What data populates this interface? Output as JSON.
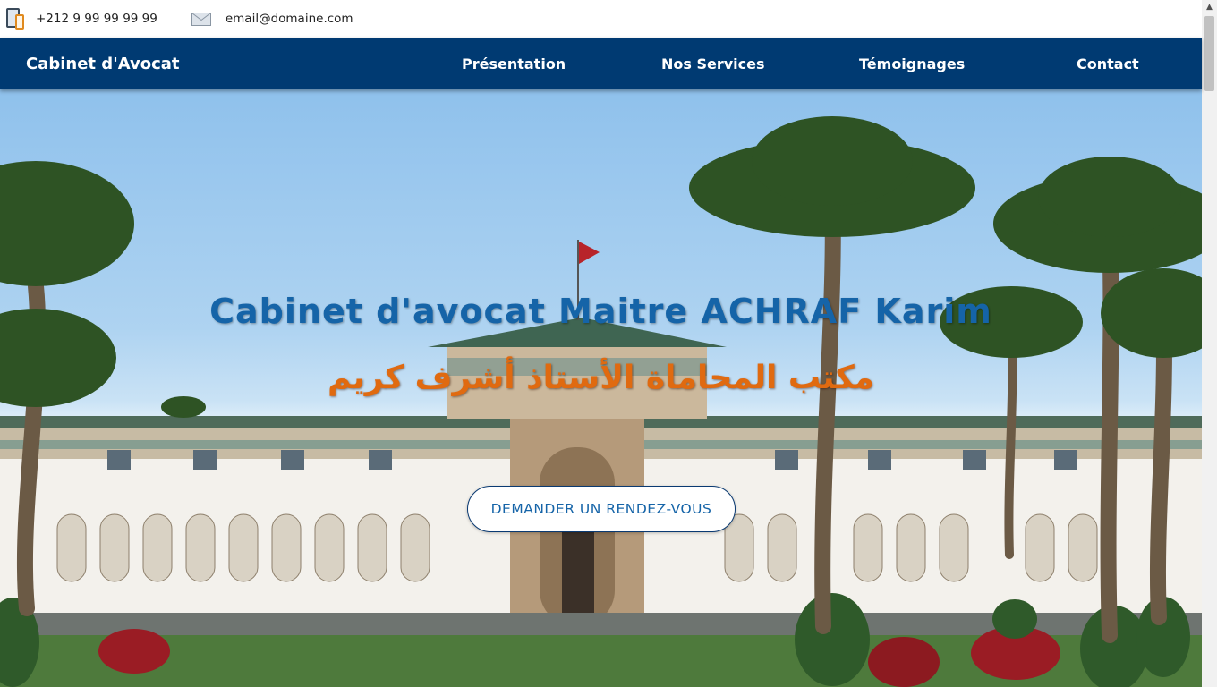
{
  "contact": {
    "phone": "+212 9 99 99 99 99",
    "email": "email@domaine.com"
  },
  "navbar": {
    "brand": "Cabinet d'Avocat",
    "links": [
      "Présentation",
      "Nos Services",
      "Témoignages",
      "Contact"
    ]
  },
  "hero": {
    "title": "Cabinet d'avocat Maitre ACHRAF Karim",
    "subtitle_arabic": "مكتب المحاماة الأستاذ أشرف كريم",
    "cta_label": "DEMANDER UN RENDEZ-VOUS"
  },
  "icons": {
    "phone": "phone-tablet-icon",
    "email": "envelope-icon"
  },
  "colors": {
    "navbar": "#003a72",
    "title": "#1564a8",
    "arabic": "#e06a10"
  }
}
